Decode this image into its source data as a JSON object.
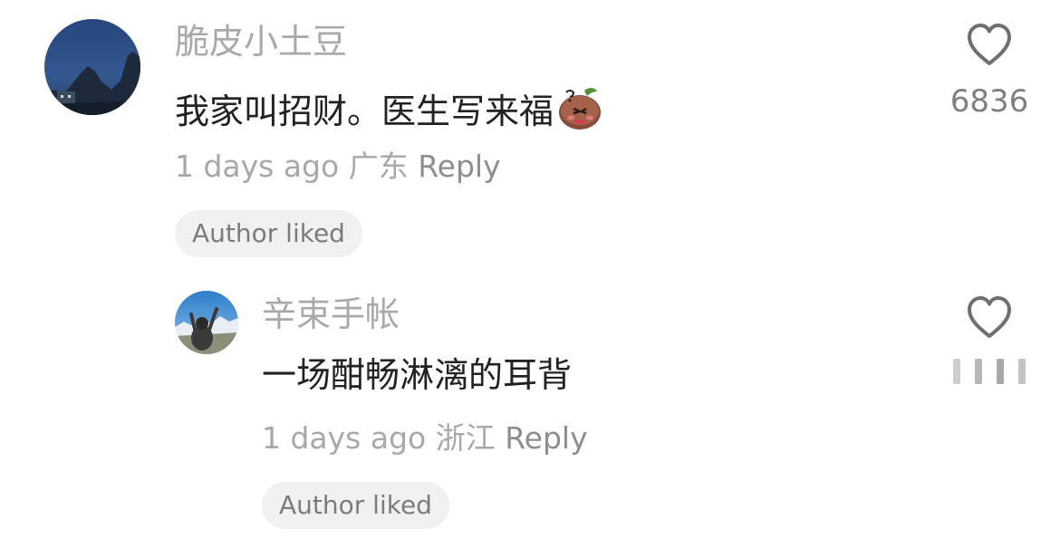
{
  "comments": [
    {
      "username": "脆皮小土豆",
      "text": "我家叫招财。医生写来福",
      "emoji": "shy-potato-emoji",
      "time": "1 days ago",
      "location": "广东",
      "reply_label": "Reply",
      "badge": "Author liked",
      "like_count": "6836"
    },
    {
      "username": "辛束手帐",
      "text": "一场酣畅淋漓的耳背",
      "time": "1 days ago",
      "location": "浙江",
      "reply_label": "Reply",
      "badge": "Author liked",
      "like_count": ""
    }
  ],
  "icons": {
    "like": "heart-outline-icon",
    "loading": "like-count-loading-icon"
  },
  "colors": {
    "username": "#a9a9a9",
    "text": "#222222",
    "meta": "#a8a8a8",
    "badge_bg": "#f1f1f1",
    "badge_text": "#7c7c7c",
    "heart": "#6f6f6f"
  }
}
